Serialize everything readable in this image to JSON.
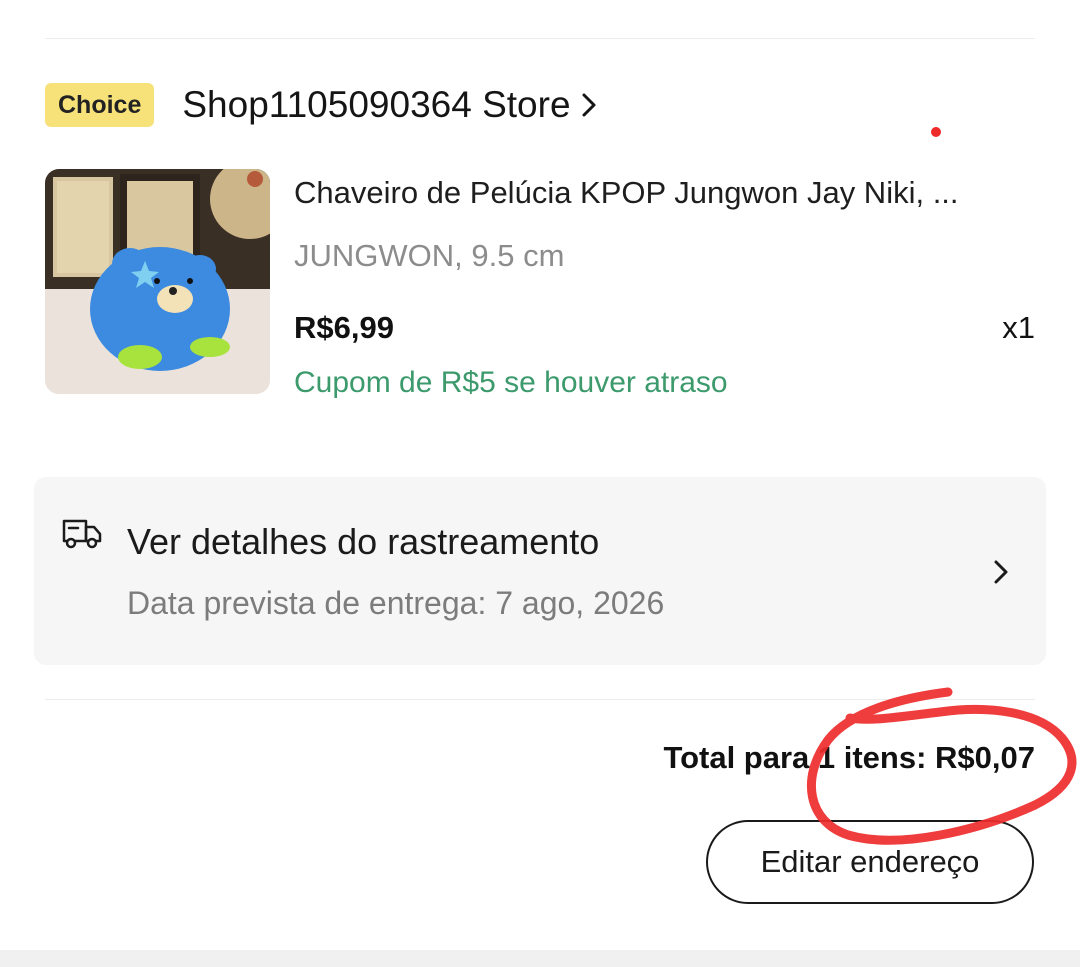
{
  "shop": {
    "badge": "Choice",
    "name": "Shop1105090364 Store",
    "chevron_icon": "chevron-right-icon"
  },
  "product": {
    "title": "Chaveiro de Pelúcia KPOP Jungwon Jay Niki, ...",
    "variant": "JUNGWON, 9.5 cm",
    "price": "R$6,99",
    "quantity": "x1",
    "coupon": "Cupom de R$5 se houver atraso",
    "image_icon": "plush-bear-keychain-photo"
  },
  "tracking": {
    "icon": "truck-icon",
    "title": "Ver detalhes do rastreamento",
    "subtitle": "Data prevista de entrega: 7 ago, 2026",
    "chevron_icon": "chevron-right-icon"
  },
  "order": {
    "total": "Total para 1 itens: R$0,07",
    "edit_button": "Editar endereço"
  },
  "colors": {
    "choice_badge": "#f7e27a",
    "coupon_green": "#3c9a6c",
    "annotation_red": "#ee2b2b"
  }
}
